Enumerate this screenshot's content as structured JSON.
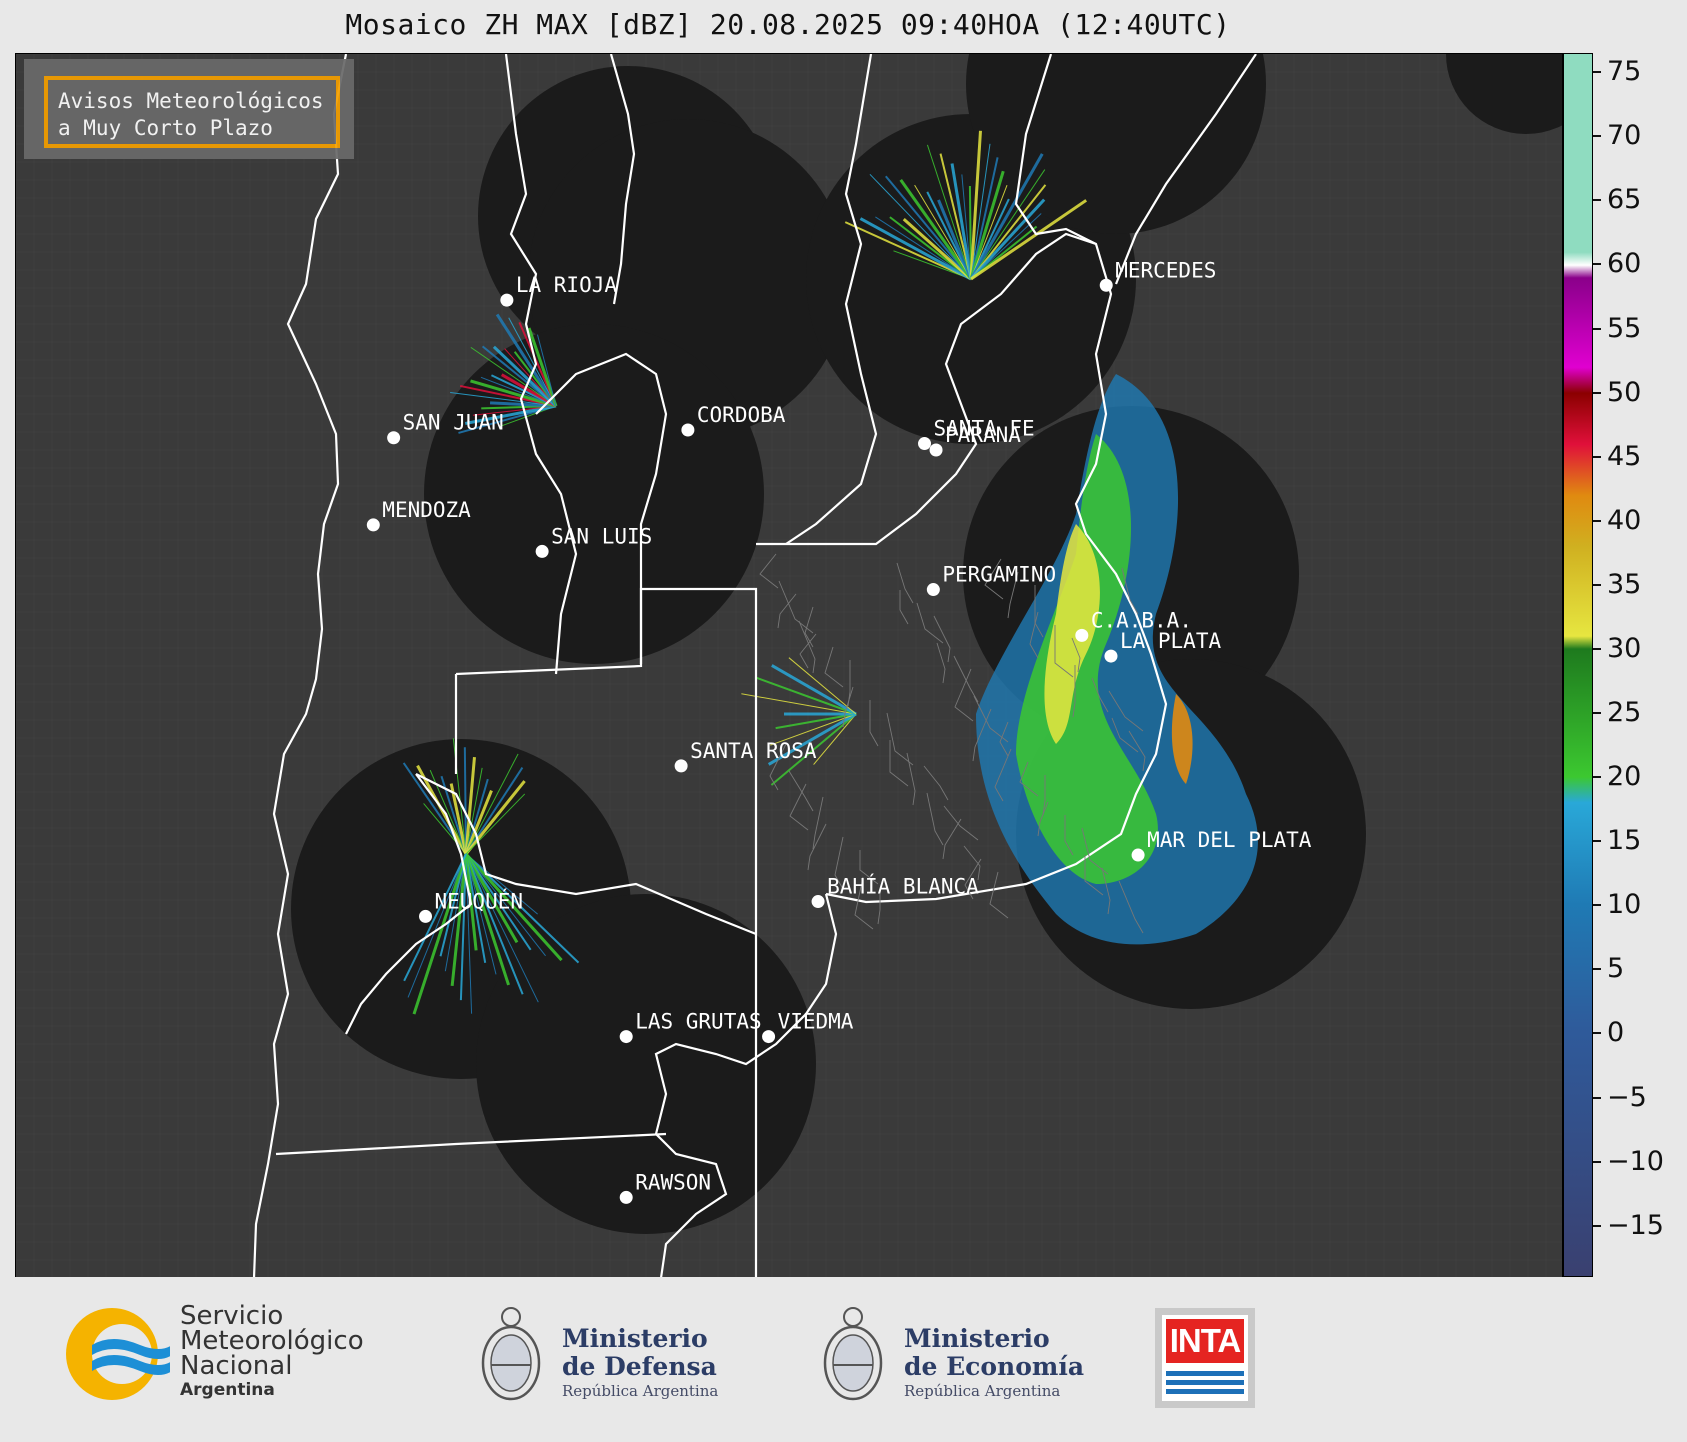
{
  "title": "Mosaico ZH MAX [dBZ] 20.08.2025 09:40HOA (12:40UTC)",
  "badge": {
    "line1": "Avisos Meteorológicos",
    "line2": "a Muy Corto Plazo"
  },
  "cities": [
    {
      "name": "LA RIOJA",
      "lon": -66.86,
      "lat": -29.41
    },
    {
      "name": "MERCEDES",
      "lon": -58.02,
      "lat": -29.18
    },
    {
      "name": "CORDOBA",
      "lon": -64.19,
      "lat": -31.42
    },
    {
      "name": "SAN JUAN",
      "lon": -68.53,
      "lat": -31.54
    },
    {
      "name": "SANTA FE",
      "lon": -60.7,
      "lat": -31.63
    },
    {
      "name": "PARANA",
      "lon": -60.53,
      "lat": -31.73
    },
    {
      "name": "MENDOZA",
      "lon": -68.83,
      "lat": -32.89
    },
    {
      "name": "SAN LUIS",
      "lon": -66.34,
      "lat": -33.3
    },
    {
      "name": "PERGAMINO",
      "lon": -60.57,
      "lat": -33.89
    },
    {
      "name": "C.A.B.A.",
      "lon": -58.38,
      "lat": -34.6
    },
    {
      "name": "LA PLATA",
      "lon": -57.95,
      "lat": -34.92
    },
    {
      "name": "SANTA ROSA",
      "lon": -64.29,
      "lat": -36.62
    },
    {
      "name": "MAR DEL PLATA",
      "lon": -57.55,
      "lat": -38.0
    },
    {
      "name": "BAHÍA BLANCA",
      "lon": -62.27,
      "lat": -38.72
    },
    {
      "name": "NEUQUÉN",
      "lon": -68.06,
      "lat": -38.95
    },
    {
      "name": "LAS GRUTAS",
      "lon": -65.1,
      "lat": -40.81
    },
    {
      "name": "VIEDMA",
      "lon": -63.0,
      "lat": -40.81
    },
    {
      "name": "RAWSON",
      "lon": -65.1,
      "lat": -43.3
    }
  ],
  "colorbar": {
    "ticks": [
      "75",
      "70",
      "65",
      "60",
      "55",
      "50",
      "45",
      "40",
      "35",
      "30",
      "25",
      "20",
      "15",
      "10",
      "5",
      "0",
      "−5",
      "−10",
      "−15"
    ],
    "colors": {
      "low": "#3a4070",
      "blue": "#1f7ab4",
      "cyan": "#29a8d8",
      "green": "#3cc830",
      "dkgreen": "#1e7a1e",
      "yellow": "#e6e640",
      "orange": "#e08a10",
      "red": "#e0103a",
      "maroon": "#8b0000",
      "magenta": "#e000d0",
      "purple": "#8a008a",
      "white": "#ffffff",
      "mint": "#8fdcc0"
    }
  },
  "footer": {
    "smn_l1": "Servicio",
    "smn_l2": "Meteorológico",
    "smn_l3": "Nacional",
    "smn_sub": "Argentina",
    "def_l1": "Ministerio",
    "def_l2": "de Defensa",
    "def_l3": "República Argentina",
    "eco_l1": "Ministerio",
    "eco_l2": "de Economía",
    "eco_l3": "República Argentina",
    "inta": "INTA"
  }
}
